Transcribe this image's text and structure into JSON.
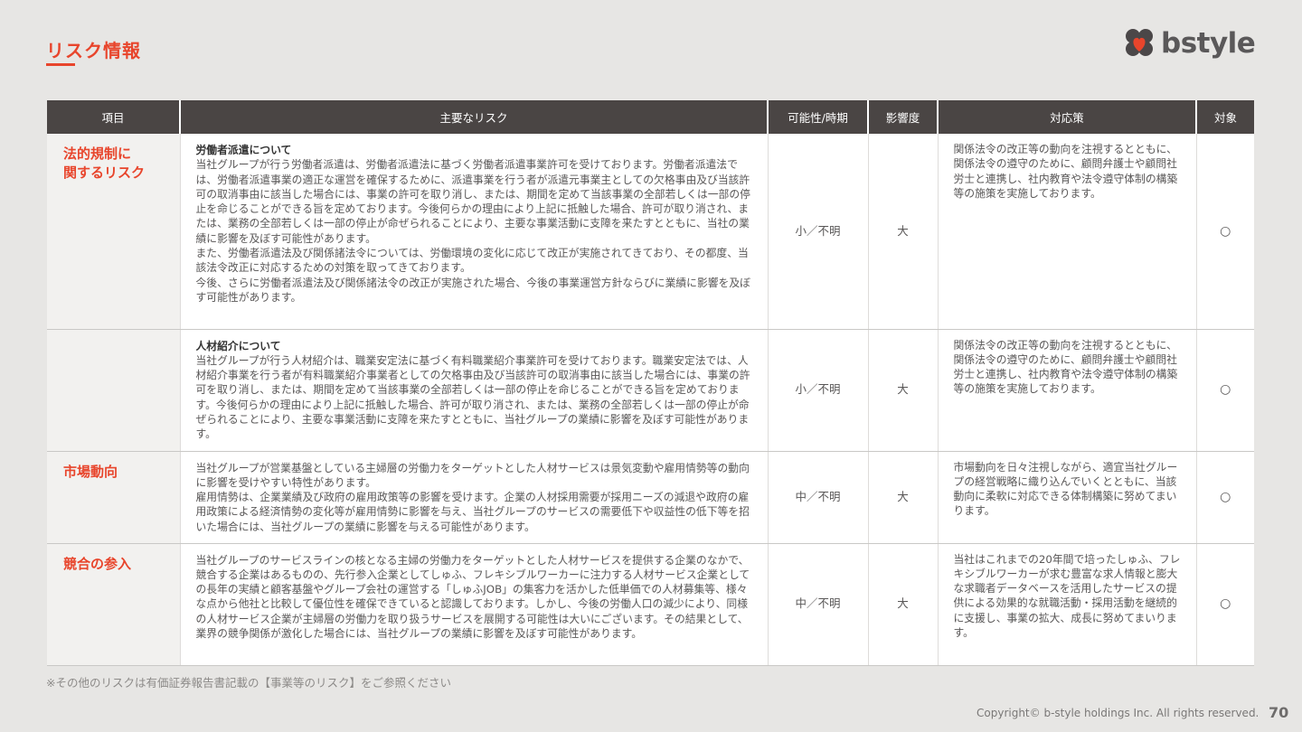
{
  "page": {
    "title": "リスク情報",
    "logo_text": "bstyle",
    "footnote": "※その他のリスクは有価証券報告書記載の【事業等のリスク】をご参照ください",
    "copyright": "Copyright© b-style holdings Inc. All rights reserved.",
    "page_number": "70",
    "colors": {
      "accent": "#e8452c",
      "header_bg": "#4a4544",
      "page_bg": "#e7e6e4"
    },
    "icons": {
      "logo": "clover-heart-logo-icon"
    }
  },
  "table": {
    "headers": [
      "項目",
      "主要なリスク",
      "可能性/時期",
      "影響度",
      "対応策",
      "対象"
    ],
    "rows": [
      {
        "category": "法的規制に\n関するリスク",
        "risk_title": "労働者派遣について",
        "risk_body": "当社グループが行う労働者派遣は、労働者派遣法に基づく労働者派遣事業許可を受けております。労働者派遣法では、労働者派遣事業の適正な運営を確保するために、派遣事業を行う者が派遣元事業主としての欠格事由及び当該許可の取消事由に該当した場合には、事業の許可を取り消し、または、期間を定めて当該事業の全部若しくは一部の停止を命じることができる旨を定めております。今後何らかの理由により上記に抵触した場合、許可が取り消され、または、業務の全部若しくは一部の停止が命ぜられることにより、主要な事業活動に支障を来たすとともに、当社の業績に影響を及ぼす可能性があります。\nまた、労働者派遣法及び関係諸法令については、労働環境の変化に応じて改正が実施されてきており、その都度、当該法令改正に対応するための対策を取ってきております。\n今後、さらに労働者派遣法及び関係諸法令の改正が実施された場合、今後の事業運営方針ならびに業績に影響を及ぼす可能性があります。",
        "likelihood": "小／不明",
        "impact": "大",
        "measure": "関係法令の改正等の動向を注視するとともに、関係法令の遵守のために、顧問弁護士や顧問社労士と連携し、社内教育や法令遵守体制の構築等の施策を実施しております。",
        "target": "○"
      },
      {
        "category": "",
        "risk_title": "人材紹介について",
        "risk_body": "当社グループが行う人材紹介は、職業安定法に基づく有料職業紹介事業許可を受けております。職業安定法では、人材紹介事業を行う者が有料職業紹介事業者としての欠格事由及び当該許可の取消事由に該当した場合には、事業の許可を取り消し、または、期間を定めて当該事業の全部若しくは一部の停止を命じることができる旨を定めております。今後何らかの理由により上記に抵触した場合、許可が取り消され、または、業務の全部若しくは一部の停止が命ぜられることにより、主要な事業活動に支障を来たすとともに、当社グループの業績に影響を及ぼす可能性があります。",
        "likelihood": "小／不明",
        "impact": "大",
        "measure": "関係法令の改正等の動向を注視するとともに、関係法令の遵守のために、顧問弁護士や顧問社労士と連携し、社内教育や法令遵守体制の構築等の施策を実施しております。",
        "target": "○"
      },
      {
        "category": "市場動向",
        "risk_title": "",
        "risk_body": "当社グループが営業基盤としている主婦層の労働力をターゲットとした人材サービスは景気変動や雇用情勢等の動向に影響を受けやすい特性があります。\n雇用情勢は、企業業績及び政府の雇用政策等の影響を受けます。企業の人材採用需要が採用ニーズの減退や政府の雇用政策による経済情勢の変化等が雇用情勢に影響を与え、当社グループのサービスの需要低下や収益性の低下等を招いた場合には、当社グループの業績に影響を与える可能性があります。",
        "likelihood": "中／不明",
        "impact": "大",
        "measure": "市場動向を日々注視しながら、適宜当社グループの経営戦略に織り込んでいくとともに、当該動向に柔軟に対応できる体制構築に努めてまいります。",
        "target": "○"
      },
      {
        "category": "競合の参入",
        "risk_title": "",
        "risk_body": "当社グループのサービスラインの核となる主婦の労働力をターゲットとした人材サービスを提供する企業のなかで、競合する企業はあるものの、先行参入企業としてしゅふ、フレキシブルワーカーに注力する人材サービス企業としての長年の実績と顧客基盤やグループ会社の運営する「しゅふJOB」の集客力を活かした低単価での人材募集等、様々な点から他社と比較して優位性を確保できていると認識しております。しかし、今後の労働人口の減少により、同様の人材サービス企業が主婦層の労働力を取り扱うサービスを展開する可能性は大いにございます。その結果として、業界の競争関係が激化した場合には、当社グループの業績に影響を及ぼす可能性があります。",
        "likelihood": "中／不明",
        "impact": "大",
        "measure": "当社はこれまでの20年間で培ったしゅふ、フレキシブルワーカーが求む豊富な求人情報と膨大な求職者データベースを活用したサービスの提供による効果的な就職活動・採用活動を継続的に支援し、事業の拡大、成長に努めてまいります。",
        "target": "○"
      }
    ]
  }
}
